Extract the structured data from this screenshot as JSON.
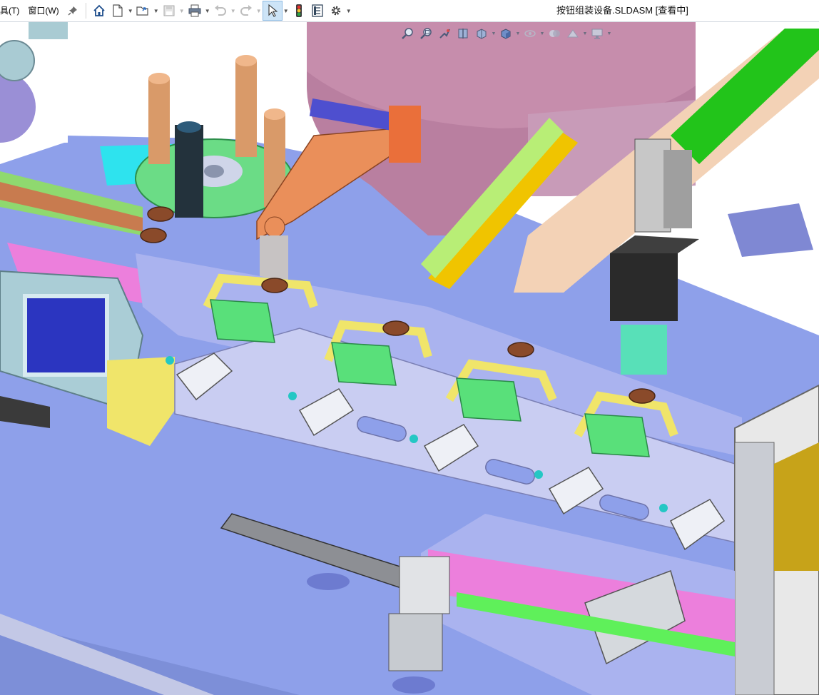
{
  "menubar": {
    "tools_label": "具(T)",
    "window_label": "窗口(W)"
  },
  "toolbar": {
    "icons": [
      "pin-icon",
      "home-icon",
      "new-document-icon",
      "open-icon",
      "save-icon",
      "print-icon",
      "undo-icon",
      "redo-icon",
      "select-icon",
      "rebuild-icon",
      "file-properties-icon",
      "options-icon"
    ]
  },
  "document": {
    "title": "按钮组装设备.SLDASM [查看中]"
  },
  "headsup_toolbar": {
    "icons": [
      "zoom-to-fit-icon",
      "zoom-area-icon",
      "previous-view-icon",
      "section-view-icon",
      "view-orientation-icon",
      "display-style-icon",
      "hide-show-items-icon",
      "edit-appearance-icon",
      "apply-scene-icon",
      "view-settings-icon"
    ]
  },
  "colors": {
    "viewport_top": "#ffffff",
    "floor": "#8ea0ea",
    "plate": "#c9cdf2",
    "accent_green": "#59e07a",
    "pink": "#ec7fdc",
    "yellow": "#f0e56a",
    "copper": "#e6915a"
  }
}
